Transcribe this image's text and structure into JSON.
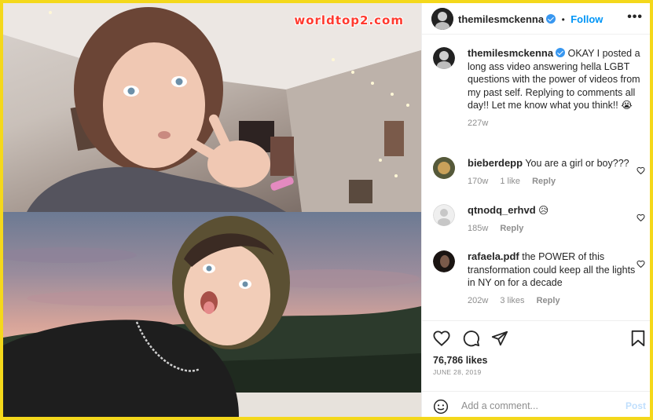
{
  "watermark": "worldtop2.com",
  "header": {
    "username": "themilesmckenna",
    "follow_separator": "•",
    "follow_label": "Follow",
    "more": "•••"
  },
  "caption": {
    "username": "themilesmckenna",
    "text": "OKAY I posted a long ass video answering hella LGBT questions with the power of videos from my past self. Replying to comments all day!! Let me know what you think!! 😭",
    "age": "227w"
  },
  "comments": [
    {
      "username": "bieberdepp",
      "text": "You are a girl or boy???",
      "age": "170w",
      "likes": "1 like",
      "reply": "Reply"
    },
    {
      "username": "qtnodq_erhvd",
      "text": "😥",
      "age": "185w",
      "likes": "",
      "reply": "Reply"
    },
    {
      "username": "rafaela.pdf",
      "text": "the POWER of this transformation could keep all the lights in NY on for a decade",
      "age": "202w",
      "likes": "3 likes",
      "reply": "Reply"
    }
  ],
  "footer": {
    "likes": "76,786 likes",
    "date": "JUNE 28, 2019",
    "add_comment_placeholder": "Add a comment...",
    "post_label": "Post"
  },
  "colors": {
    "frame": "#f4d81b",
    "link": "#0095f6",
    "verified": "#3897f0",
    "muted": "#8e8e8e"
  }
}
